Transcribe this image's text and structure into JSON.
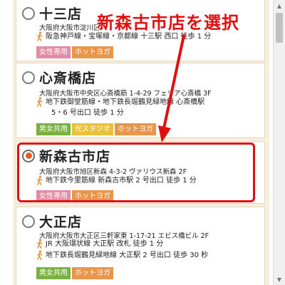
{
  "annotation": {
    "text": "新森古市店を選択"
  },
  "stores": [
    {
      "name": "十三店",
      "selected": false,
      "address": "大阪府大阪市淀川区",
      "access": [
        "阪急神戸線・宝塚線・京都線 十三駅 西口 徒歩 1 分"
      ],
      "tags": [
        {
          "label": "女性専用",
          "color": "#e48aa4"
        },
        {
          "label": "ホットヨガ",
          "color": "#e8964a"
        }
      ]
    },
    {
      "name": "心斎橋店",
      "selected": false,
      "address": "大阪府大阪市中央区心斎橋筋 1-4-29 フェリア心斎橋 3F",
      "access": [
        "地下鉄御堂筋線・地下鉄長堀鶴見緑地線 心斎橋駅",
        "5・6 号出口 徒歩 1 分"
      ],
      "tags": [
        {
          "label": "男女共用",
          "color": "#7bb23f"
        },
        {
          "label": "光スタジオ",
          "color": "#e8c23a"
        },
        {
          "label": "ホットヨガ",
          "color": "#e8964a"
        }
      ]
    },
    {
      "name": "新森古市店",
      "selected": true,
      "address": "大阪府大阪市旭区新森 4-3-2 ヴァリウス新森 2F",
      "access": [
        "地下鉄今里筋線 新森古市駅 2 号出口 徒歩 1 分"
      ],
      "tags": [
        {
          "label": "女性専用",
          "color": "#e48aa4"
        },
        {
          "label": "ホットヨガ",
          "color": "#e8964a"
        }
      ]
    },
    {
      "name": "大正店",
      "selected": false,
      "address": "大阪府大阪市大正区三軒家東 1-17-21 エビス橋ビル 2F",
      "access": [
        "JR 大阪環状線 大正駅 改札 徒歩 1 分",
        "地下鉄長堀鶴見緑地線 大正駅 2 号出口 徒歩 30 秒"
      ],
      "tags": [
        {
          "label": "男女共用",
          "color": "#7bb23f"
        },
        {
          "label": "ホットヨガ",
          "color": "#e8964a"
        }
      ]
    }
  ],
  "scrollbar": {
    "up_icon": "triangle-up-icon",
    "down_icon": "triangle-down-icon"
  }
}
